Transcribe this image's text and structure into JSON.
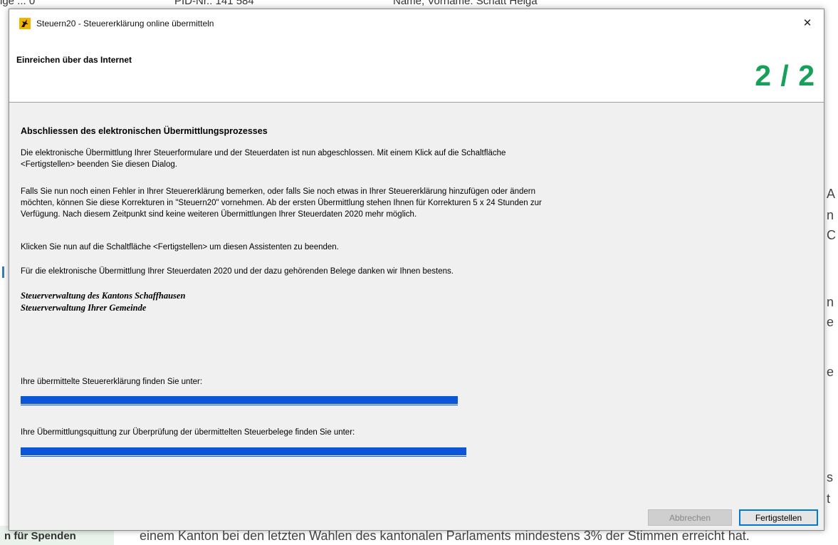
{
  "background": {
    "top_fragments": [
      "ige ... 0",
      "PID-Nr.: 141 584",
      "Name, Vorname: Schatt Helga"
    ],
    "right_fragments": [
      "A",
      "n",
      "C",
      "n",
      "e",
      "e",
      "s",
      "t"
    ],
    "bottom_left": "n für Spenden",
    "bottom_text": "einem Kanton bei den letzten Wahlen des kantonalen Parlaments mindestens 3% der Stimmen erreicht hat."
  },
  "window": {
    "title": "Steuern20 - Steuererklärung online übermitteln",
    "close_symbol": "✕"
  },
  "header": {
    "title": "Einreichen über das Internet",
    "step": "2 / 2",
    "step_color": "#16a05a"
  },
  "content": {
    "heading": "Abschliessen des elektronischen Übermittlungsprozesses",
    "para1_line1": "Die elektronische Übermittlung Ihrer Steuerformulare und der Steuerdaten ist nun abgeschlossen. Mit einem Klick auf die Schaltfläche",
    "para1_line2": "<Fertigstellen> beenden Sie diesen Dialog.",
    "para2_line1": "Falls Sie nun noch einen Fehler in Ihrer Steuererklärung bemerken, oder falls Sie noch etwas in Ihrer Steuererklärung hinzufügen oder ändern",
    "para2_line2": "möchten, können Sie diese Korrekturen in \"Steuern20\" vornehmen. Ab der ersten Übermittlung stehen Ihnen für Korrekturen 5 x 24 Stunden zur",
    "para2_line3": "Verfügung. Nach diesem Zeitpunkt sind keine weiteren Übermittlungen Ihrer Steuerdaten 2020 mehr möglich.",
    "para3": "Klicken Sie nun auf die Schaltfläche <Fertigstellen> um diesen Assistenten zu beenden.",
    "para4": "Für die elektronische Übermittlung Ihrer Steuerdaten 2020 und der dazu gehörenden Belege danken wir Ihnen bestens.",
    "signature_line1": "Steuerverwaltung des Kantons Schaffhausen",
    "signature_line2": "Steuerverwaltung Ihrer Gemeinde",
    "link1_label": "Ihre übermittelte Steuererklärung finden Sie unter:",
    "link2_label": "Ihre Übermittlungsquittung zur Überprüfung der übermittelten Steuerbelege finden Sie unter:",
    "link_color": "#0a55d8"
  },
  "buttons": {
    "cancel_label": "Abbrechen",
    "cancel_enabled": false,
    "finish_label": "Fertigstellen"
  }
}
